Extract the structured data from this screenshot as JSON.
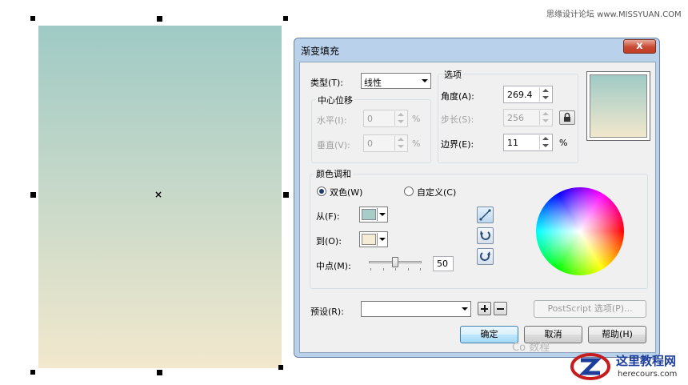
{
  "watermarks": {
    "top_right": "思缘设计论坛 www.MISSYUAN.COM",
    "bottom_site": "这里教程网",
    "bottom_url": "herecours.com",
    "wechat_overlay": "Co 数程"
  },
  "canvas": {
    "gradient_start": "#9fcac5",
    "gradient_end": "#f2e8cd",
    "center_marker": "×"
  },
  "dialog": {
    "title": "渐变填充",
    "close_label": "x",
    "type_label": "类型(T):",
    "type_value": "线性",
    "center_offset": {
      "legend": "中心位移",
      "horizontal_label": "水平(I):",
      "horizontal_value": "0",
      "vertical_label": "垂直(V):",
      "vertical_value": "0",
      "unit": "%"
    },
    "options": {
      "legend": "选项",
      "angle_label": "角度(A):",
      "angle_value": "269.4",
      "steps_label": "步长(S):",
      "steps_value": "256",
      "edge_label": "边界(E):",
      "edge_value": "11",
      "edge_unit": "%"
    },
    "color_blend": {
      "legend": "颜色调和",
      "two_color_label": "双色(W)",
      "custom_label": "自定义(C)",
      "selected": "双色(W)",
      "from_label": "从(F):",
      "from_color": "#a7cdc8",
      "to_label": "到(O):",
      "to_color": "#f5ecd6",
      "midpoint_label": "中点(M):",
      "midpoint_value": "50",
      "midpoint": 50
    },
    "presets": {
      "label": "预设(R):",
      "value": "",
      "postscript_label": "PostScript 选项(P)..."
    },
    "buttons": {
      "ok": "确定",
      "cancel": "取消",
      "help": "帮助(H)"
    }
  }
}
